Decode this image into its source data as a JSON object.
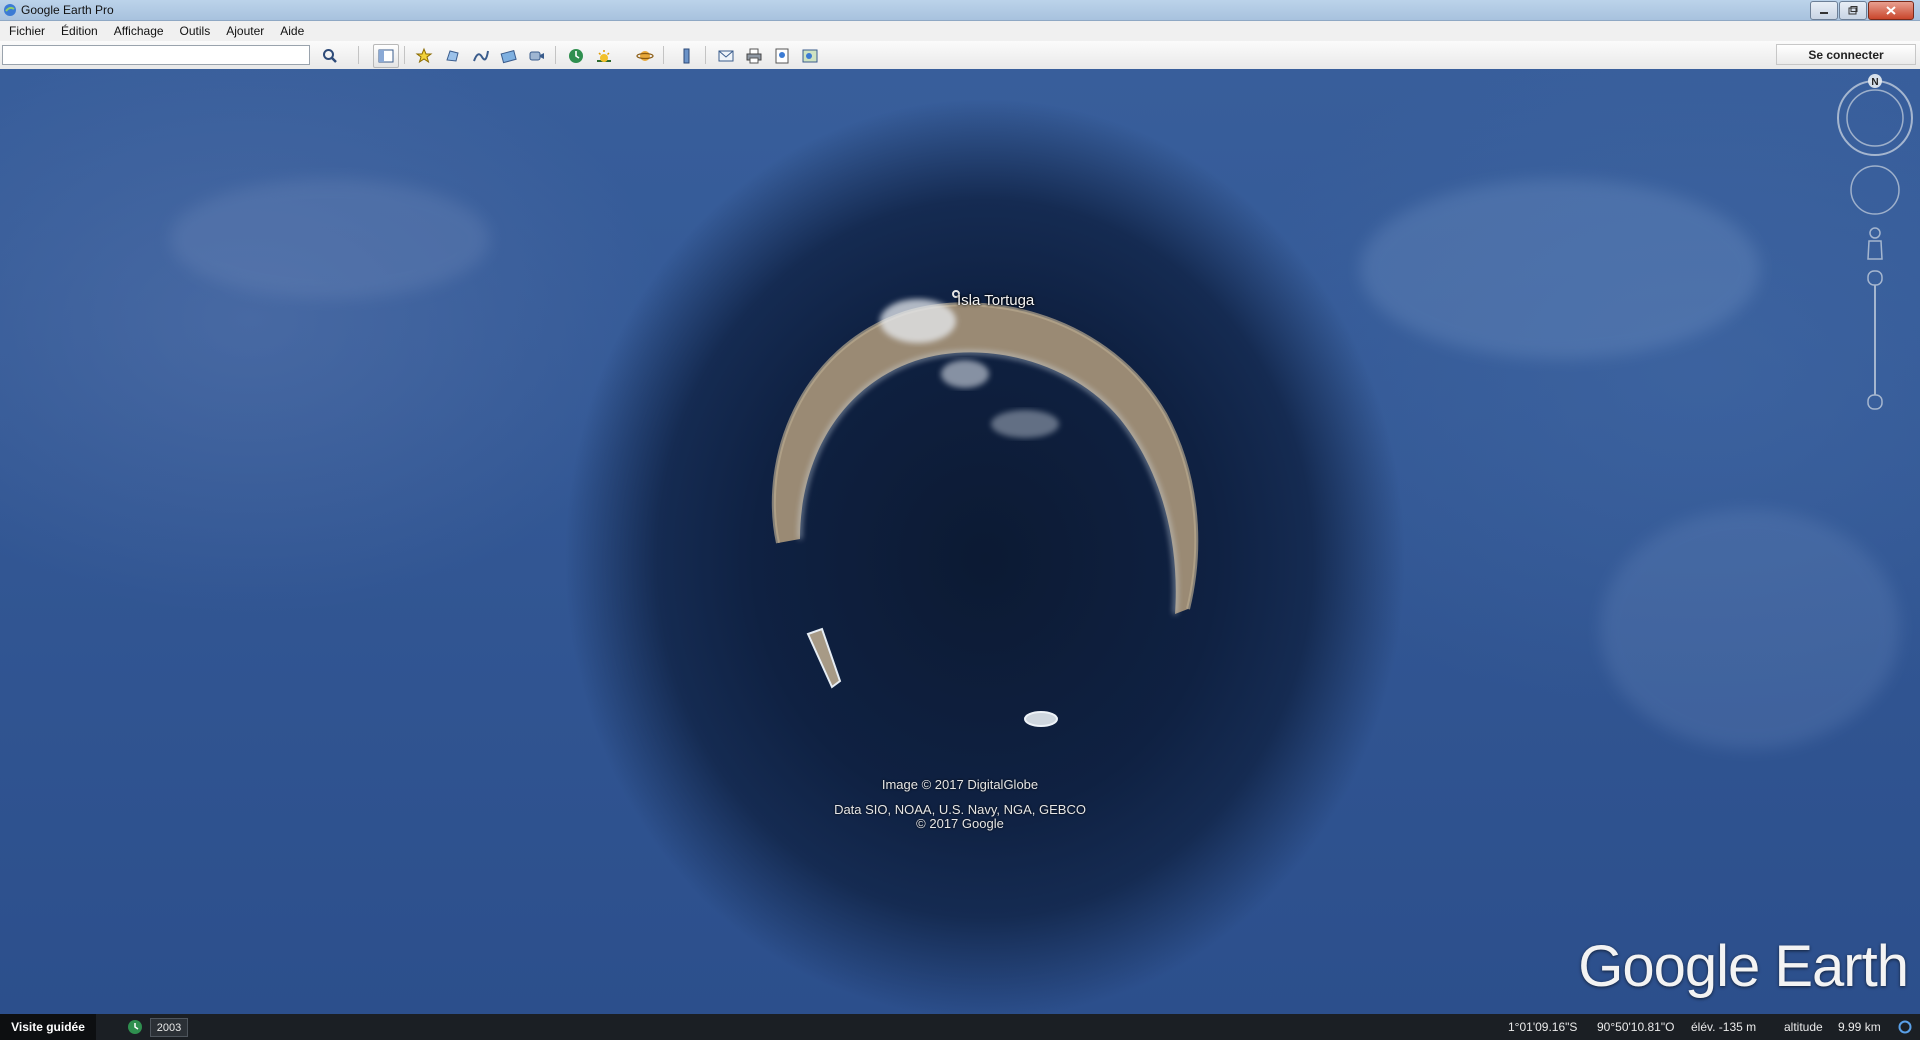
{
  "window": {
    "title": "Google Earth Pro"
  },
  "menu": {
    "items": [
      "Fichier",
      "Édition",
      "Affichage",
      "Outils",
      "Ajouter",
      "Aide"
    ]
  },
  "toolbar": {
    "search_value": "",
    "signin_label": "Se connecter"
  },
  "map": {
    "place_label": "Isla Tortuga",
    "image_credit": "Image © 2017 DigitalGlobe",
    "data_credit": "Data SIO, NOAA, U.S. Navy, NGA, GEBCO",
    "copyright": "© 2017 Google",
    "brand": "Google Earth",
    "compass_north": "N"
  },
  "status": {
    "tour_label": "Visite guidée",
    "year": "2003",
    "latitude": "1°01'09.16\"S",
    "longitude": "90°50'10.81\"O",
    "elevation": "élév.  -135 m",
    "altitude_label": "altitude",
    "altitude_value": "9.99 km"
  }
}
